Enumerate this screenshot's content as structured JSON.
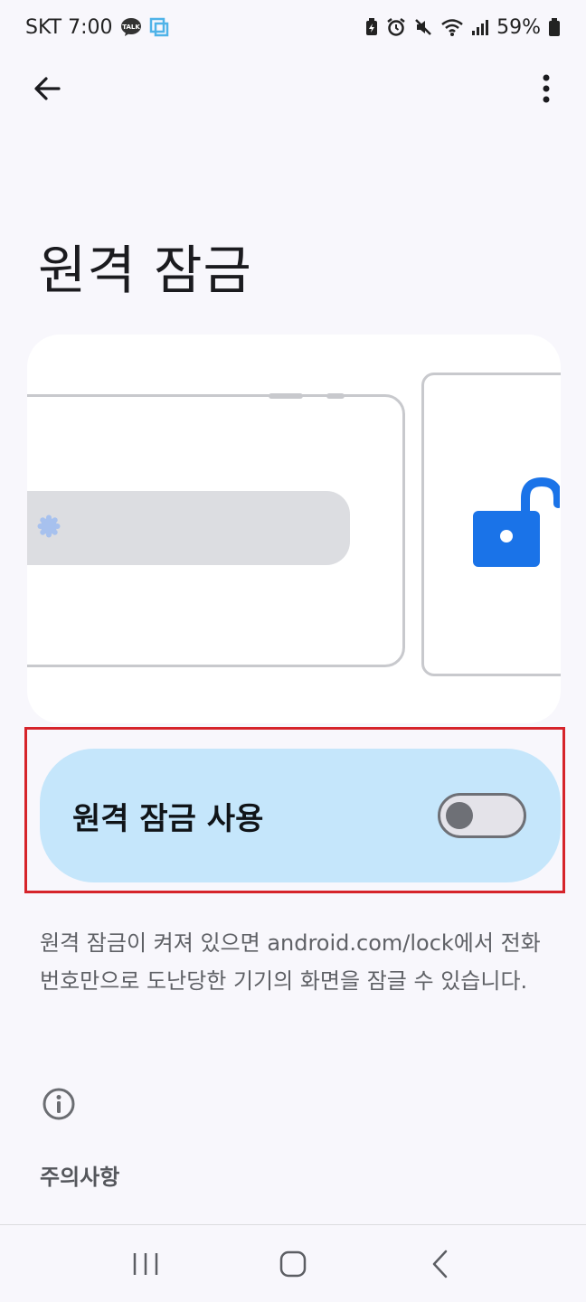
{
  "status_bar": {
    "carrier_time": "SKT 7:00",
    "battery": "59%",
    "icons": [
      "kakaotalk-icon",
      "screen-capture-icon",
      "battery-saver-icon",
      "alarm-icon",
      "mute-icon",
      "wifi-icon",
      "signal-icon",
      "battery-icon"
    ]
  },
  "app_bar": {
    "back_icon": "back-arrow-icon",
    "menu_icon": "more-vert-icon"
  },
  "page": {
    "title": "원격 잠금"
  },
  "toggle": {
    "label": "원격 잠금 사용",
    "state": "off"
  },
  "description": "원격 잠금이 켜져 있으면 android.com/lock에서 전화번호만으로 도난당한 기기의 화면을 잠글 수 있습니다.",
  "notice": {
    "icon": "info-icon",
    "title": "주의사항"
  },
  "nav_bar": {
    "icons": [
      "recents-icon",
      "home-icon",
      "back-icon"
    ]
  },
  "colors": {
    "accent": "#1a73e8",
    "toggle_card": "#c5e6fb",
    "highlight": "#d6242b"
  }
}
